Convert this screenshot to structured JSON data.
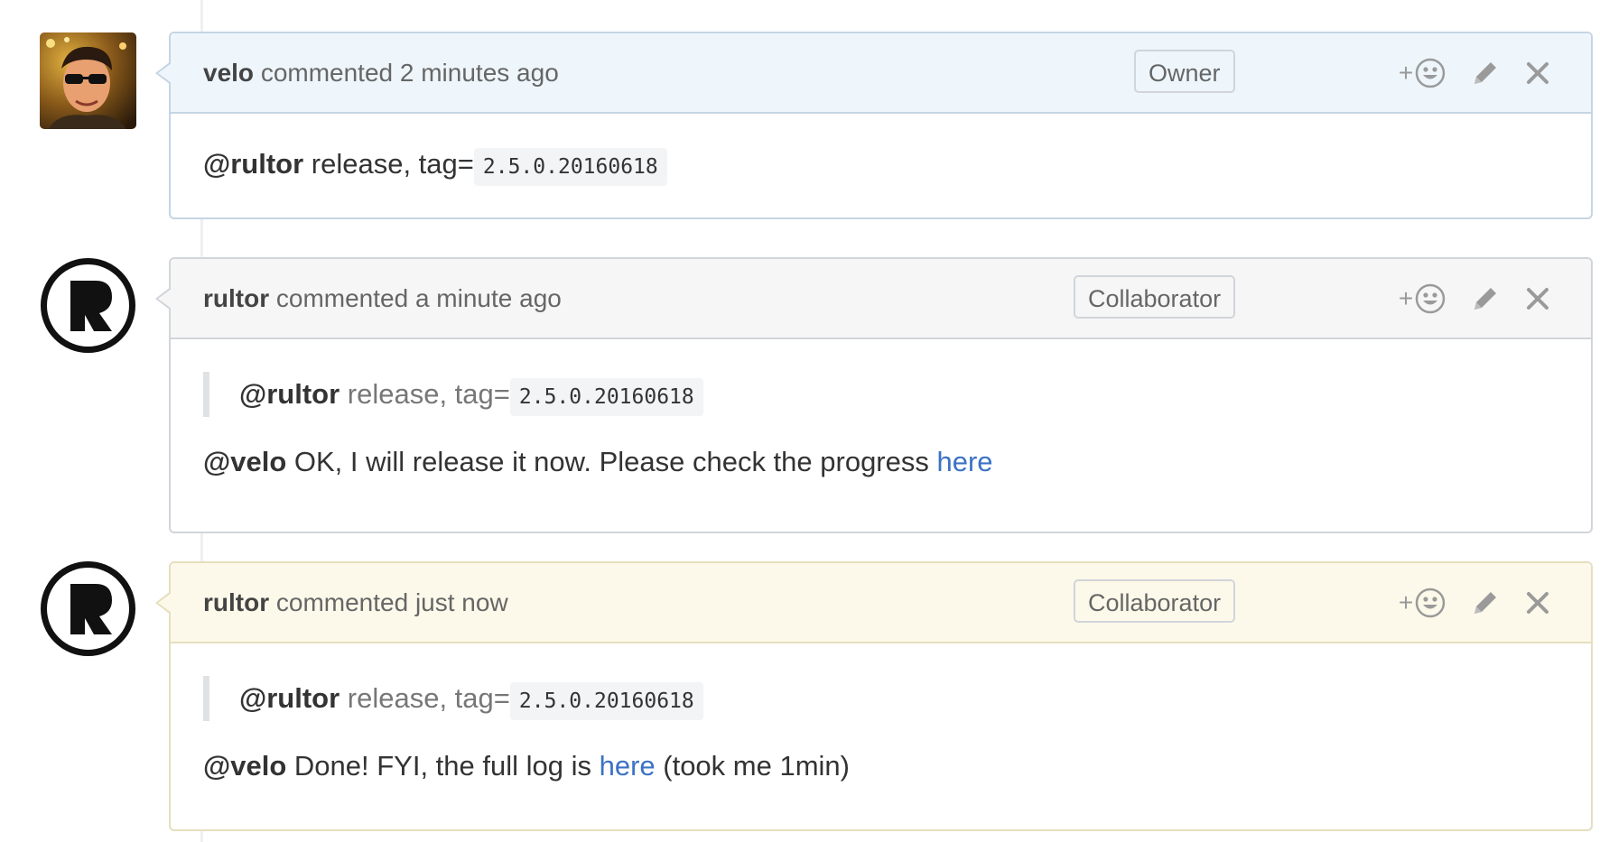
{
  "comments": [
    {
      "author": "velo",
      "action": "commented 2 minutes ago",
      "role": "Owner",
      "add_reaction": "+",
      "body": {
        "mention": "@rultor",
        "text": " release, tag=",
        "code": "2.5.0.20160618"
      }
    },
    {
      "author": "rultor",
      "action": "commented a minute ago",
      "role": "Collaborator",
      "add_reaction": "+",
      "quote": {
        "mention": "@rultor",
        "text": " release, tag=",
        "code": "2.5.0.20160618"
      },
      "body": {
        "mention": "@velo",
        "text": " OK, I will release it now. Please check the progress ",
        "link": "here"
      }
    },
    {
      "author": "rultor",
      "action": "commented just now",
      "role": "Collaborator",
      "add_reaction": "+",
      "quote": {
        "mention": "@rultor",
        "text": " release, tag=",
        "code": "2.5.0.20160618"
      },
      "body": {
        "mention": "@velo",
        "text": " Done! FYI, the full log is ",
        "link": "here",
        "suffix": " (took me 1min)"
      }
    }
  ],
  "colors": {
    "link": "#3b73c4",
    "header_owner": "#eef6fb",
    "header_bot": "#f6f6f6",
    "header_latest": "#fdf9ea"
  },
  "icons": [
    "user-avatar-photo",
    "rultor-logo-icon",
    "smiley-icon",
    "pencil-icon",
    "close-icon"
  ]
}
